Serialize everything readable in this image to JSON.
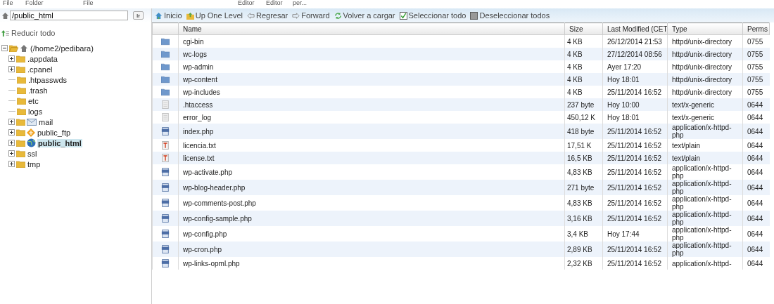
{
  "top_menu": [
    "File",
    "Folder",
    "File",
    "Editor",
    "Editor",
    "per..."
  ],
  "path_field": {
    "value": "/public_html",
    "button": "Ir"
  },
  "collapse_all": "Reducir todo",
  "tree": {
    "label": "(/home2/pedibara)",
    "kind": "home",
    "expanded": true,
    "selected": false,
    "children": [
      {
        "label": ".appdata",
        "kind": "folder",
        "expandable": true,
        "selected": false
      },
      {
        "label": ".cpanel",
        "kind": "folder",
        "expandable": true,
        "selected": false
      },
      {
        "label": ".htpasswds",
        "kind": "folder",
        "expandable": false,
        "selected": false
      },
      {
        "label": ".trash",
        "kind": "folder",
        "expandable": false,
        "selected": false
      },
      {
        "label": "etc",
        "kind": "folder",
        "expandable": false,
        "selected": false
      },
      {
        "label": "logs",
        "kind": "folder",
        "expandable": false,
        "selected": false
      },
      {
        "label": "mail",
        "kind": "mail",
        "expandable": true,
        "selected": false
      },
      {
        "label": "public_ftp",
        "kind": "ftp",
        "expandable": true,
        "selected": false
      },
      {
        "label": "public_html",
        "kind": "web",
        "expandable": true,
        "selected": true
      },
      {
        "label": "ssl",
        "kind": "folder",
        "expandable": true,
        "selected": false
      },
      {
        "label": "tmp",
        "kind": "folder",
        "expandable": true,
        "selected": false
      }
    ]
  },
  "toolbar": [
    {
      "label": "Inicio",
      "kind": "home"
    },
    {
      "label": "Up One Level",
      "kind": "up"
    },
    {
      "label": "Regresar",
      "kind": "back"
    },
    {
      "label": "Forward",
      "kind": "forward"
    },
    {
      "label": "Volver a cargar",
      "kind": "reload"
    },
    {
      "label": "Seleccionar todo",
      "kind": "check"
    },
    {
      "label": "Deseleccionar todos",
      "kind": "uncheck"
    }
  ],
  "table": {
    "columns": [
      "Name",
      "Size",
      "Last Modified (CET",
      "Type",
      "Perms"
    ],
    "rows": [
      {
        "kind": "folder",
        "name": "cgi-bin",
        "size": "4 KB",
        "modified": "26/12/2014 21:53",
        "type": "httpd/unix-directory",
        "perms": "0755"
      },
      {
        "kind": "folder",
        "name": "wc-logs",
        "size": "4 KB",
        "modified": "27/12/2014 08:56",
        "type": "httpd/unix-directory",
        "perms": "0755"
      },
      {
        "kind": "folder",
        "name": "wp-admin",
        "size": "4 KB",
        "modified": "Ayer 17:20",
        "type": "httpd/unix-directory",
        "perms": "0755"
      },
      {
        "kind": "folder",
        "name": "wp-content",
        "size": "4 KB",
        "modified": "Hoy 18:01",
        "type": "httpd/unix-directory",
        "perms": "0755"
      },
      {
        "kind": "folder",
        "name": "wp-includes",
        "size": "4 KB",
        "modified": "25/11/2014 16:52",
        "type": "httpd/unix-directory",
        "perms": "0755"
      },
      {
        "kind": "generic",
        "name": ".htaccess",
        "size": "237 byte",
        "modified": "Hoy 10:00",
        "type": "text/x-generic",
        "perms": "0644"
      },
      {
        "kind": "generic",
        "name": "error_log",
        "size": "450,12 K",
        "modified": "Hoy 18:01",
        "type": "text/x-generic",
        "perms": "0644"
      },
      {
        "kind": "php",
        "name": "index.php",
        "size": "418 byte",
        "modified": "25/11/2014 16:52",
        "type": "application/x-httpd-php",
        "perms": "0644"
      },
      {
        "kind": "text",
        "name": "licencia.txt",
        "size": "17,51 K",
        "modified": "25/11/2014 16:52",
        "type": "text/plain",
        "perms": "0644"
      },
      {
        "kind": "text",
        "name": "license.txt",
        "size": "16,5 KB",
        "modified": "25/11/2014 16:52",
        "type": "text/plain",
        "perms": "0644"
      },
      {
        "kind": "php",
        "name": "wp-activate.php",
        "size": "4,83 KB",
        "modified": "25/11/2014 16:52",
        "type": "application/x-httpd-php",
        "perms": "0644"
      },
      {
        "kind": "php",
        "name": "wp-blog-header.php",
        "size": "271 byte",
        "modified": "25/11/2014 16:52",
        "type": "application/x-httpd-php",
        "perms": "0644"
      },
      {
        "kind": "php",
        "name": "wp-comments-post.php",
        "size": "4,83 KB",
        "modified": "25/11/2014 16:52",
        "type": "application/x-httpd-php",
        "perms": "0644"
      },
      {
        "kind": "php",
        "name": "wp-config-sample.php",
        "size": "3,16 KB",
        "modified": "25/11/2014 16:52",
        "type": "application/x-httpd-php",
        "perms": "0644"
      },
      {
        "kind": "php",
        "name": "wp-config.php",
        "size": "3,4 KB",
        "modified": "Hoy 17:44",
        "type": "application/x-httpd-php",
        "perms": "0644"
      },
      {
        "kind": "php",
        "name": "wp-cron.php",
        "size": "2,89 KB",
        "modified": "25/11/2014 16:52",
        "type": "application/x-httpd-php",
        "perms": "0644"
      },
      {
        "kind": "php",
        "name": "wp-links-opml.php",
        "size": "2,32 KB",
        "modified": "25/11/2014 16:52",
        "type": "application/x-httpd-",
        "perms": "0644"
      }
    ]
  }
}
